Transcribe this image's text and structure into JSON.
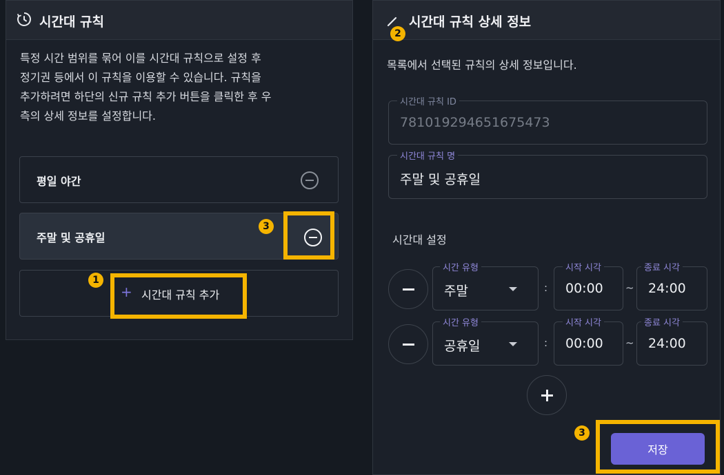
{
  "left_panel": {
    "title": "시간대 규칙",
    "description_lines": [
      "특정 시간 범위를 묶어 이를 시간대 규칙으로 설정 후",
      "정기권 등에서 이 규칙을 이용할 수 있습니다. 규칙을",
      "추가하려면 하단의 신규 규칙 추가 버튼을 클릭한 후 우",
      "측의 상세 정보를 설정합니다."
    ],
    "rules": [
      {
        "label": "평일 야간",
        "selected": false
      },
      {
        "label": "주말 및 공휴일",
        "selected": true
      }
    ],
    "add_button_label": "시간대 규칙 추가",
    "add_icon": "+"
  },
  "right_panel": {
    "title": "시간대 규칙 상세 정보",
    "description": "목록에서 선택된 규칙의 상세 정보입니다.",
    "rule_id": {
      "label": "시간대 규칙 ID",
      "value": "781019294651675473"
    },
    "rule_name": {
      "label": "시간대 규칙 명",
      "value": "주말 및 공휴일"
    },
    "time_settings_label": "시간대 설정",
    "time_rows": [
      {
        "type_label": "시간 유형",
        "type_value": "주말",
        "start_label": "시작 시각",
        "start_value": "00:00",
        "end_label": "종료 시각",
        "end_value": "24:00"
      },
      {
        "type_label": "시간 유형",
        "type_value": "공휴일",
        "start_label": "시작 시각",
        "start_value": "00:00",
        "end_label": "종료 시각",
        "end_value": "24:00"
      }
    ],
    "colon": ":",
    "tilde": "~",
    "save_label": "저장"
  },
  "badges": {
    "b1": "1",
    "b2": "2",
    "b3a": "3",
    "b3b": "3"
  },
  "colors": {
    "accent": "#6a62d6",
    "highlight": "#f5b400",
    "background": "#151a21"
  }
}
